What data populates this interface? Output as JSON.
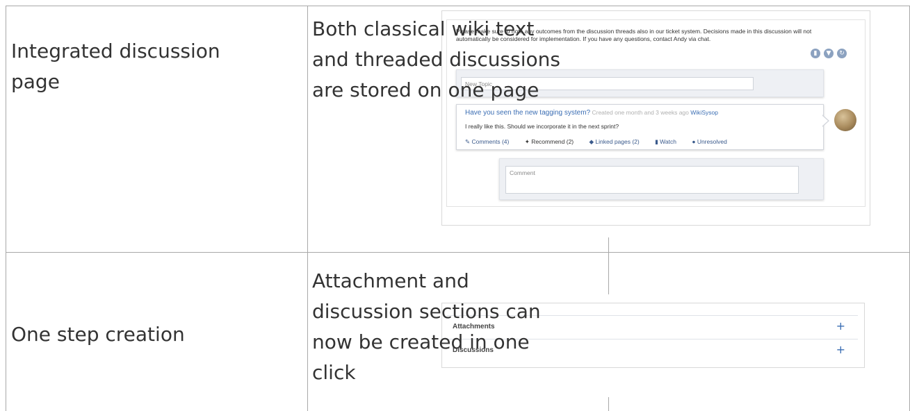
{
  "rows": [
    {
      "feature": "Integrated discussion\npage",
      "description": "Both classical wiki text\nand threaded discussions\nare stored on one page"
    },
    {
      "feature": "One step creation",
      "description": "Attachment and\ndiscussion sections can\nnow be created in one\nclick"
    }
  ],
  "discussion_shot": {
    "notice": "Please make sure to note any outcomes from the discussion threads also in our ticket system. Decisions made in this discussion will not automatically be considered for implementation. If you have any questions, contact Andy via chat.",
    "icons": [
      "sort-icon",
      "filter-icon",
      "refresh-icon"
    ],
    "new_topic_placeholder": "New Topic",
    "topic": {
      "title": "Have you seen the new tagging system?",
      "meta": "Created one month and 3 weeks ago",
      "author": "WikiSysop",
      "body": "I really like this. Should we incorporate it in the next sprint?",
      "actions": {
        "comments": "Comments (4)",
        "recommend": "Recommend (2)",
        "linked": "Linked pages (2)",
        "watch": "Watch",
        "status": "Unresolved"
      }
    },
    "comment_placeholder": "Comment"
  },
  "sections_shot": {
    "attachments_label": "Attachments",
    "discussions_label": "Discussions",
    "add_symbol": "+"
  },
  "colors": {
    "link": "#3a6db3",
    "icon_button": "#8ca2c0",
    "grid_line": "#a8a8a8"
  }
}
